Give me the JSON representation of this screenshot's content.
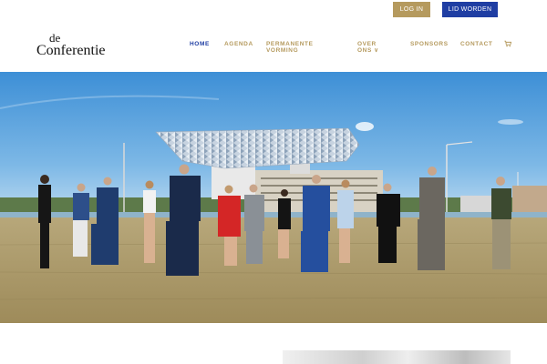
{
  "header": {
    "login_label": "LOG IN",
    "member_label": "LID WORDEN",
    "logo_line1": "de",
    "logo_line2": "Conferentie"
  },
  "nav": {
    "items": [
      {
        "label": "HOME",
        "active": true
      },
      {
        "label": "AGENDA",
        "active": false
      },
      {
        "label": "PERMANENTE",
        "label2": "VORMING",
        "active": false
      },
      {
        "label": "OVER",
        "label2": "ONS ∨",
        "active": false
      },
      {
        "label": "SPONSORS",
        "active": false
      },
      {
        "label": "CONTACT",
        "active": false
      }
    ],
    "cart_icon": "cart-icon"
  },
  "colors": {
    "gold": "#b59a5e",
    "blue": "#1f3ea3"
  },
  "hero": {
    "image": "group-photo-port-house"
  }
}
